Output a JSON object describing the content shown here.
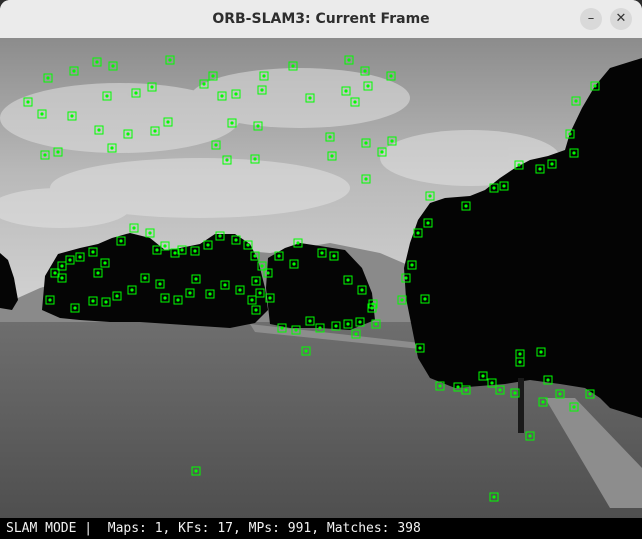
{
  "window": {
    "title": "ORB-SLAM3: Current Frame",
    "minimize_glyph": "–",
    "close_glyph": "✕"
  },
  "status": {
    "text": "SLAM MODE |  Maps: 1, KFs: 17, MPs: 991, Matches: 398"
  },
  "colors": {
    "keypoint": "#00ff00",
    "status_bg": "#000000",
    "titlebar_bg": "#ebebeb"
  }
}
